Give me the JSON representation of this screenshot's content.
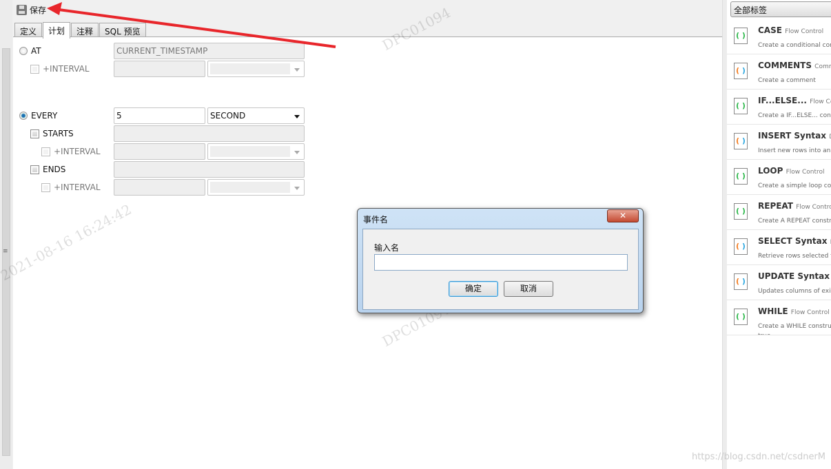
{
  "toolbar": {
    "save_label": "保存",
    "save_icon": "floppy-disk-icon"
  },
  "tabs": [
    {
      "label": "定义"
    },
    {
      "label": "计划",
      "active": true
    },
    {
      "label": "注释"
    },
    {
      "label": "SQL 预览"
    }
  ],
  "schedule": {
    "at": {
      "label": "AT",
      "selected": false,
      "value": "CURRENT_TIMESTAMP",
      "interval_label": "+INTERVAL"
    },
    "every": {
      "label": "EVERY",
      "selected": true,
      "value": "5",
      "unit": "SECOND"
    },
    "starts": {
      "label": "STARTS",
      "interval_label": "+INTERVAL"
    },
    "ends": {
      "label": "ENDS",
      "interval_label": "+INTERVAL"
    }
  },
  "right_panel": {
    "tag_filter": "全部标签",
    "snippets": [
      {
        "title": "CASE",
        "category": "Flow Control",
        "desc": "Create a conditional con",
        "kind": "flow"
      },
      {
        "title": "COMMENTS",
        "category": "Comm",
        "desc": "Create a comment",
        "kind": "dml"
      },
      {
        "title": "IF...ELSE...",
        "category": "Flow Cont",
        "desc": "Create a IF...ELSE... constr",
        "kind": "flow"
      },
      {
        "title": "INSERT Syntax",
        "category": "DM",
        "desc": "Insert new rows into an e",
        "kind": "dml"
      },
      {
        "title": "LOOP",
        "category": "Flow Control",
        "desc": "Create a simple loop con",
        "kind": "flow"
      },
      {
        "title": "REPEAT",
        "category": "Flow Control",
        "desc": "Create A REPEAT constru",
        "kind": "flow"
      },
      {
        "title": "SELECT Syntax",
        "category": "DM",
        "desc": "Retrieve rows selected fr",
        "kind": "dml"
      },
      {
        "title": "UPDATE Syntax",
        "category": "D",
        "desc": "Updates columns of exis",
        "kind": "dml"
      },
      {
        "title": "WHILE",
        "category": "Flow Control",
        "desc": "Create a WHILE construc\ntrue.",
        "kind": "flow"
      }
    ]
  },
  "dialog": {
    "title": "事件名",
    "input_label": "输入名",
    "input_value": "",
    "ok_label": "确定",
    "cancel_label": "取消",
    "close_icon": "close-icon"
  },
  "watermarks": {
    "id": "DPC01094",
    "datetime": "2021-08-16  16:24:42",
    "site": "https://blog.csdn.net/csdnerM"
  },
  "colors": {
    "annotation_arrow": "#e8262b",
    "snippet_flow": "#2db84b"
  }
}
